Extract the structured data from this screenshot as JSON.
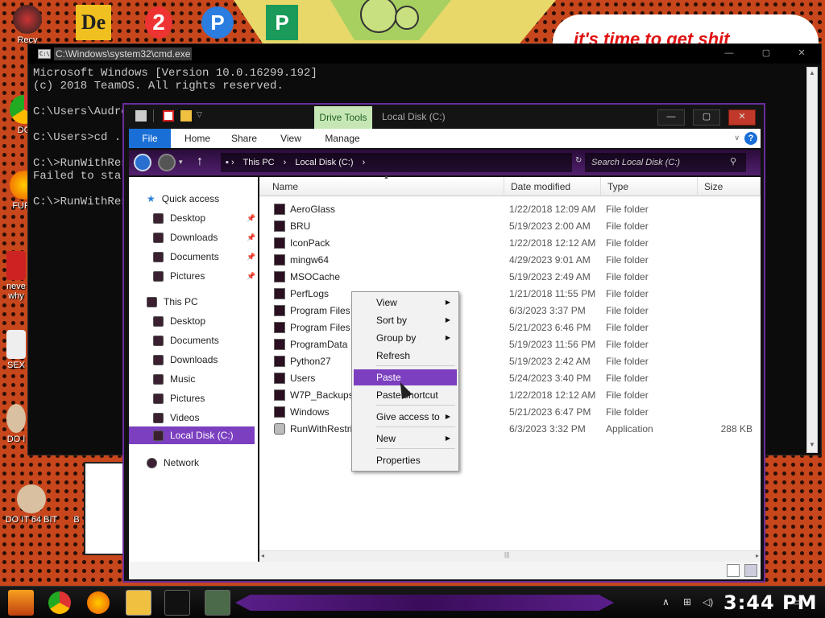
{
  "desktop": {
    "speech_text": "it's time to get shit",
    "icons": [
      {
        "label": "Recy"
      },
      {
        "label": "DO"
      },
      {
        "label": "FURF"
      },
      {
        "label": "neve why"
      },
      {
        "label": "SEX"
      },
      {
        "label": "DO I"
      },
      {
        "label": "DO IT 64 BIT"
      },
      {
        "label": "B"
      }
    ]
  },
  "cmd": {
    "title": "C:\\Windows\\system32\\cmd.exe",
    "lines": [
      "Microsoft Windows [Version 10.0.16299.192]",
      "(c) 2018 TeamOS. All rights reserved.",
      "",
      "C:\\Users\\Audre",
      "",
      "C:\\Users>cd ..",
      "",
      "C:\\>RunWithRes",
      "Failed to star",
      "",
      "C:\\>RunWithRes"
    ]
  },
  "explorer": {
    "drive_tools": "Drive Tools",
    "title": "Local Disk (C:)",
    "ribbon_tabs": [
      "File",
      "Home",
      "Share",
      "View",
      "Manage"
    ],
    "help": "?",
    "address": [
      "This PC",
      "Local Disk (C:)"
    ],
    "search_placeholder": "Search Local Disk (C:)",
    "nav": {
      "quick_access": "Quick access",
      "quick_items": [
        "Desktop",
        "Downloads",
        "Documents",
        "Pictures"
      ],
      "this_pc": "This PC",
      "pc_items": [
        "Desktop",
        "Documents",
        "Downloads",
        "Music",
        "Pictures",
        "Videos",
        "Local Disk (C:)"
      ],
      "network": "Network"
    },
    "columns": [
      "Name",
      "Date modified",
      "Type",
      "Size"
    ],
    "files": [
      {
        "name": "AeroGlass",
        "date": "1/22/2018 12:09 AM",
        "type": "File folder",
        "size": ""
      },
      {
        "name": "BRU",
        "date": "5/19/2023 2:00 AM",
        "type": "File folder",
        "size": ""
      },
      {
        "name": "IconPack",
        "date": "1/22/2018 12:12 AM",
        "type": "File folder",
        "size": ""
      },
      {
        "name": "mingw64",
        "date": "4/29/2023 9:01 AM",
        "type": "File folder",
        "size": ""
      },
      {
        "name": "MSOCache",
        "date": "5/19/2023 2:49 AM",
        "type": "File folder",
        "size": ""
      },
      {
        "name": "PerfLogs",
        "date": "1/21/2018 11:55 PM",
        "type": "File folder",
        "size": ""
      },
      {
        "name": "Program Files",
        "date": "6/3/2023 3:37 PM",
        "type": "File folder",
        "size": ""
      },
      {
        "name": "Program Files (x",
        "date": "5/21/2023 6:46 PM",
        "type": "File folder",
        "size": ""
      },
      {
        "name": "ProgramData",
        "date": "5/19/2023 11:56 PM",
        "type": "File folder",
        "size": ""
      },
      {
        "name": "Python27",
        "date": "5/19/2023 2:42 AM",
        "type": "File folder",
        "size": ""
      },
      {
        "name": "Users",
        "date": "5/24/2023 3:40 PM",
        "type": "File folder",
        "size": ""
      },
      {
        "name": "W7P_Backups",
        "date": "1/22/2018 12:12 AM",
        "type": "File folder",
        "size": ""
      },
      {
        "name": "Windows",
        "date": "5/21/2023 6:47 PM",
        "type": "File folder",
        "size": ""
      },
      {
        "name": "RunWithRestricte",
        "date": "6/3/2023 3:32 PM",
        "type": "Application",
        "size": "288 KB"
      }
    ]
  },
  "context_menu": {
    "items": [
      {
        "label": "View",
        "submenu": true
      },
      {
        "label": "Sort by",
        "submenu": true
      },
      {
        "label": "Group by",
        "submenu": true
      },
      {
        "label": "Refresh",
        "submenu": false
      },
      {
        "label": "Paste",
        "submenu": false,
        "highlighted": true
      },
      {
        "label": "Paste shortcut",
        "submenu": false
      },
      {
        "label": "Give access to",
        "submenu": true
      },
      {
        "label": "New",
        "submenu": true
      },
      {
        "label": "Properties",
        "submenu": false
      }
    ]
  },
  "taskbar": {
    "clock": "3:44 PM"
  },
  "colors": {
    "accent": "#7b3fbf",
    "file_tab": "#1a6fd6",
    "drive_tools": "#c6e7b5"
  }
}
